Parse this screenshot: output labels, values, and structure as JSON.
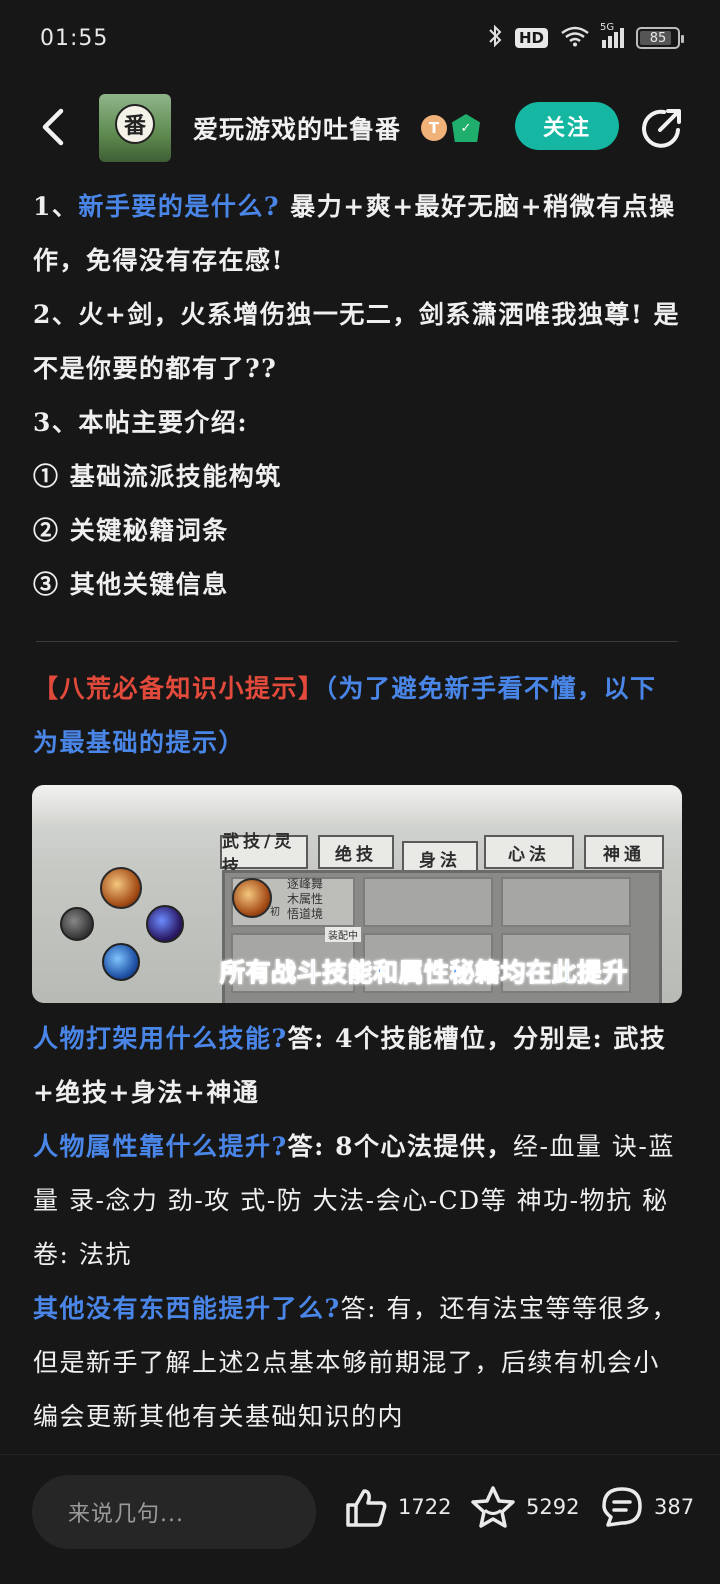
{
  "status_bar": {
    "time": "01:55",
    "hd_label": "HD",
    "network_label": "5G",
    "battery_level": 85,
    "battery_text": "85"
  },
  "header": {
    "username": "爱玩游戏的吐鲁番",
    "avatar_text": "番",
    "badge_t": "T",
    "follow_label": "关注"
  },
  "intro": {
    "p1_prefix": "1、",
    "p1_question": "新手要的是什么?",
    "p1_answer": "暴力+爽+最好无脑+稍微有点操作，免得没有存在感!",
    "p2": "2、火+剑，火系增伤独一无二，剑系潇洒唯我独尊! 是不是你要的都有了??",
    "p3": "3、本帖主要介绍:",
    "item1": "① 基础流派技能构筑",
    "item2": "② 关键秘籍词条",
    "item3": "③ 其他关键信息"
  },
  "tips": {
    "title": "【八荒必备知识小提示】",
    "note": "（为了避免新手看不懂，以下为最基础的提示）"
  },
  "game_image": {
    "tabs": [
      "武技/灵技",
      "绝技",
      "身法",
      "心法",
      "神通"
    ],
    "skill_lines": [
      "逐峰舞",
      "木属性",
      "悟道境"
    ],
    "skill_level": "初",
    "equip_tag": "装配中",
    "caption": "所有战斗技能和属性秘籍均在此提升"
  },
  "qa": {
    "q1": "人物打架用什么技能?",
    "a1": "答: 4个技能槽位，分别是: 武技+绝技+身法+神通",
    "q2": "人物属性靠什么提升?",
    "a2_label": "答: 8个心法提供，",
    "a2_detail": "经-血量 诀-蓝量 录-念力 劲-攻 式-防 大法-会心-CD等 神功-物抗 秘卷: 法抗",
    "q3": "其他没有东西能提升了么?",
    "a3": "答: 有，还有法宝等等很多，但是新手了解上述2点基本够前期混了，后续有机会小编会更新其他有关基础知识的内"
  },
  "bottom_bar": {
    "comment_placeholder": "来说几句...",
    "likes": "1722",
    "favorites": "5292",
    "comments": "387"
  },
  "colors": {
    "background": "#171717",
    "accent_teal": "#16b7a2",
    "highlight_blue": "#4a86e8",
    "highlight_red": "#e24a3b"
  },
  "icons": [
    "bluetooth-icon",
    "wifi-icon",
    "signal-icon",
    "battery-icon",
    "back-icon",
    "share-icon",
    "thumbs-up-icon",
    "star-icon",
    "comment-icon"
  ]
}
